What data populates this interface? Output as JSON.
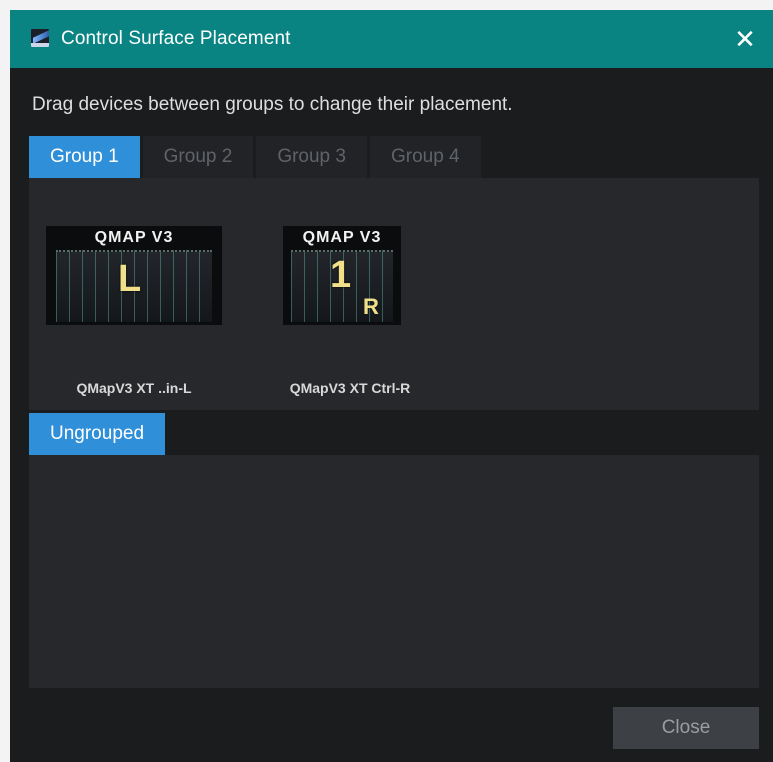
{
  "window": {
    "title": "Control Surface Placement",
    "close_glyph": "✕"
  },
  "instructions": "Drag devices between groups to change their placement.",
  "tabs": [
    {
      "label": "Group 1",
      "active": true
    },
    {
      "label": "Group 2",
      "active": false
    },
    {
      "label": "Group 3",
      "active": false
    },
    {
      "label": "Group 4",
      "active": false
    }
  ],
  "devices": [
    {
      "brand": "QMAP V3",
      "mark": "L",
      "label": "QMapV3 XT ..in-L"
    },
    {
      "brand": "QMAP V3",
      "mark": "1",
      "mark2": "R",
      "label": "QMapV3 XT Ctrl-R"
    }
  ],
  "ungrouped": {
    "label": "Ungrouped"
  },
  "footer": {
    "close_label": "Close"
  },
  "colors": {
    "titlebar": "#0a8383",
    "tab_active": "#2f8fd8",
    "panel": "#26282b",
    "window_bg": "#1b1c1e"
  }
}
